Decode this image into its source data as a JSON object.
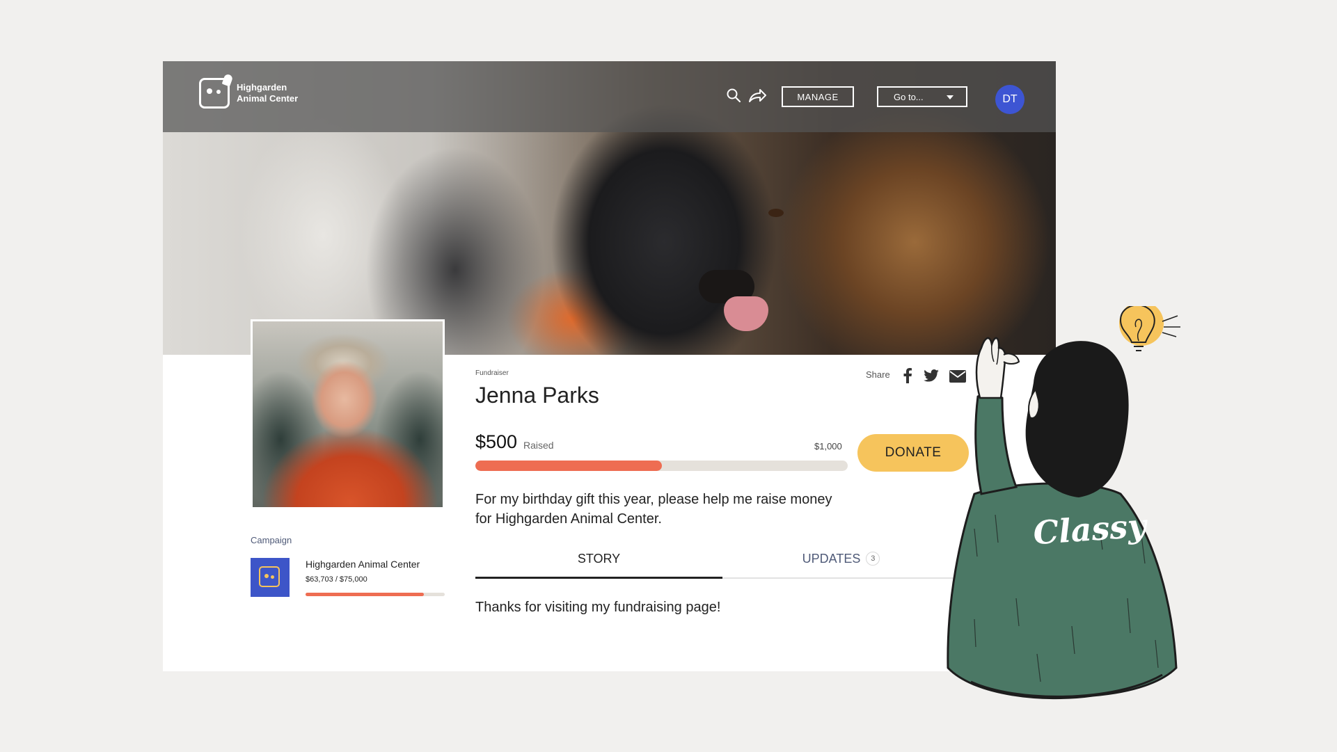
{
  "brand": {
    "name_line1": "Highgarden",
    "name_line2": "Animal Center"
  },
  "nav": {
    "manage_label": "MANAGE",
    "goto_label": "Go to...",
    "avatar_initials": "DT"
  },
  "fundraiser": {
    "eyebrow": "Fundraiser",
    "name": "Jenna Parks",
    "raised": "$500",
    "raised_label": "Raised",
    "goal": "$1,000",
    "progress_fraction": 0.5,
    "donate_label": "DONATE",
    "description": "For my birthday gift this year, please help me raise money for Highgarden Animal Center."
  },
  "share": {
    "label": "Share"
  },
  "tabs": [
    {
      "label": "STORY",
      "active": true
    },
    {
      "label": "UPDATES",
      "badge": "3"
    }
  ],
  "story_text": "Thanks for visiting my fundraising page!",
  "campaign": {
    "section_label": "Campaign",
    "name": "Highgarden Animal Center",
    "amount": "$63,703 / $75,000",
    "progress_fraction": 0.849
  },
  "illustration": {
    "sweater_text": "Classy"
  },
  "colors": {
    "accent": "#f6c45c",
    "progress": "#ee6d52",
    "avatar": "#3d55d3",
    "campaign_logo": "#3d55c8",
    "sweater": "#4b7865"
  },
  "icons": [
    "search-icon",
    "share-arrow-icon",
    "facebook-icon",
    "twitter-icon",
    "email-icon",
    "chevron-down-icon",
    "lightbulb-icon"
  ]
}
